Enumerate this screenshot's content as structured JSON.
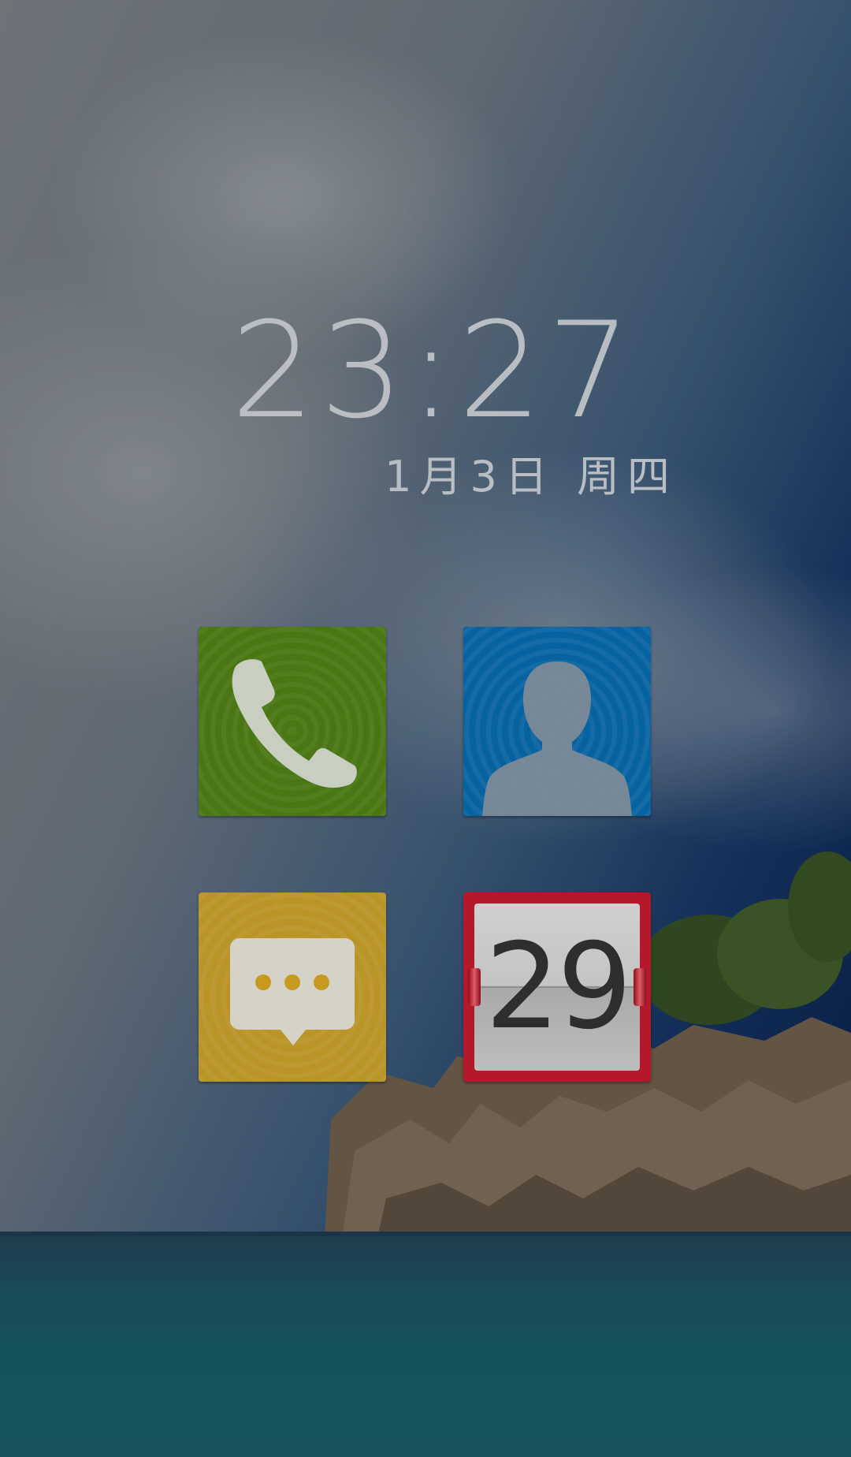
{
  "lockscreen": {
    "time": "23:27",
    "date": "1月3日 周四"
  },
  "shortcuts": {
    "phone": {
      "icon": "phone-icon",
      "color": "#4a7713"
    },
    "contacts": {
      "icon": "contact-icon",
      "color": "#0763a0"
    },
    "messages": {
      "icon": "message-icon",
      "color": "#b99427"
    },
    "calendar": {
      "icon": "calendar-icon",
      "color": "#b3182b",
      "day": "29"
    }
  }
}
